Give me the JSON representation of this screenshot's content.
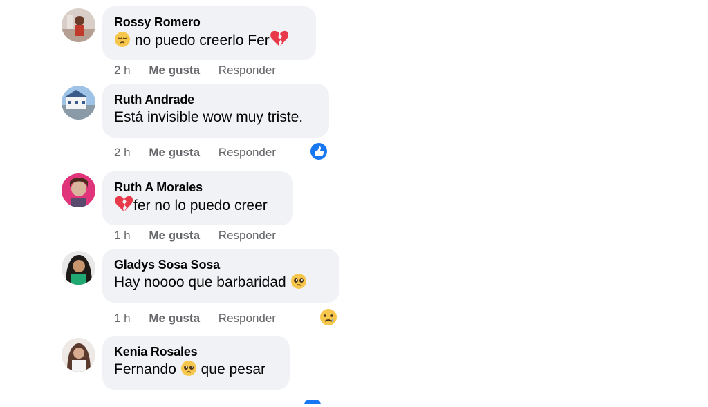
{
  "comments": [
    {
      "author": "Rossy Romero",
      "text": "no puedo creerlo Fer",
      "time": "2 h",
      "like": "Me gusta",
      "reply": "Responder"
    },
    {
      "author": "Ruth Andrade",
      "text": "Está invisible wow muy triste.",
      "time": "2 h",
      "like": "Me gusta",
      "reply": "Responder"
    },
    {
      "author": "Ruth A Morales",
      "text": "fer no lo puedo creer",
      "time": "1 h",
      "like": "Me gusta",
      "reply": "Responder"
    },
    {
      "author": "Gladys Sosa Sosa",
      "text": "Hay noooo que barbaridad",
      "time": "1 h",
      "like": "Me gusta",
      "reply": "Responder"
    },
    {
      "author": "Kenia Rosales",
      "text_before": "Fernando",
      "text_after": "que pesar"
    }
  ],
  "colors": {
    "bubble": "#f0f2f5",
    "meta": "#65676b",
    "like_blue": "#1877f2",
    "emoji_yellow": "#f7c74d",
    "heart_red": "#e8394a"
  }
}
